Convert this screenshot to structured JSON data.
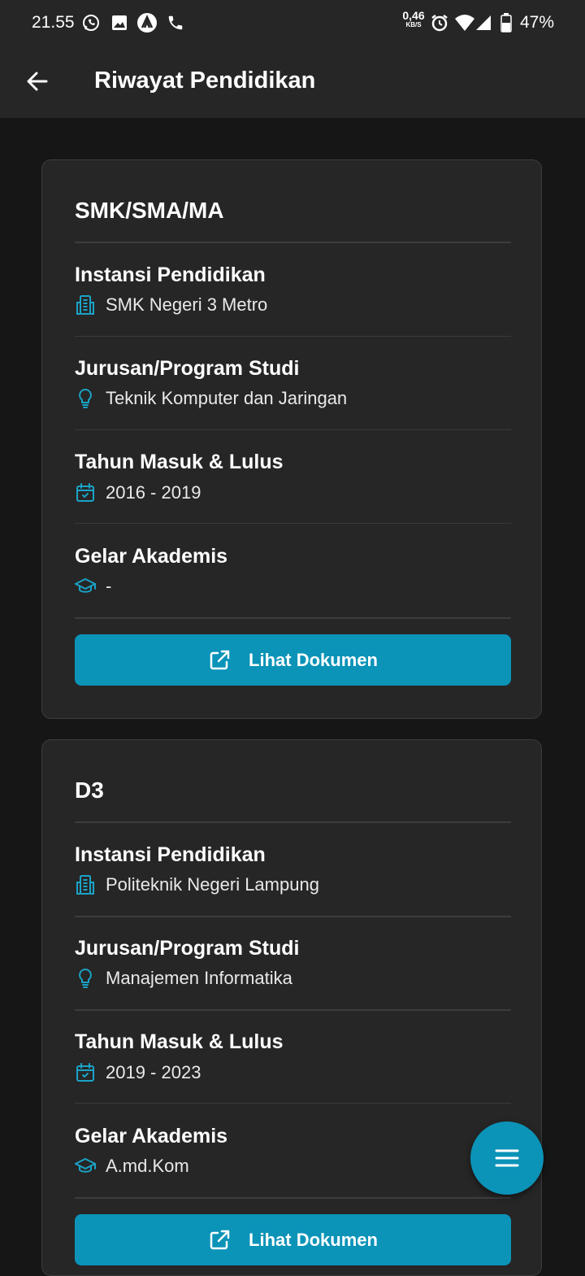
{
  "status_bar": {
    "time": "21.55",
    "net_speed_value": "0,46",
    "net_speed_unit": "KB/S",
    "battery": "47%",
    "icons": [
      "whatsapp-icon",
      "image-icon",
      "app-icon",
      "phone-icon",
      "alarm-icon",
      "wifi-icon",
      "signal-icon",
      "battery-icon"
    ]
  },
  "app_bar": {
    "title": "Riwayat Pendidikan",
    "back_icon": "arrow-left-icon"
  },
  "labels": {
    "institution": "Instansi Pendidikan",
    "major": "Jurusan/Program Studi",
    "years": "Tahun Masuk & Lulus",
    "degree": "Gelar Akademis"
  },
  "accent_color": "#0b93b8",
  "records": [
    {
      "level": "SMK/SMA/MA",
      "institution": "SMK Negeri 3 Metro",
      "major": "Teknik Komputer dan Jaringan",
      "years": "2016 - 2019",
      "degree": "-",
      "button_label": "Lihat Dokumen"
    },
    {
      "level": "D3",
      "institution": "Politeknik Negeri Lampung",
      "major": "Manajemen Informatika",
      "years": "2019 - 2023",
      "degree": "A.md.Kom",
      "button_label": "Lihat Dokumen"
    }
  ],
  "fab_icon": "menu-icon"
}
